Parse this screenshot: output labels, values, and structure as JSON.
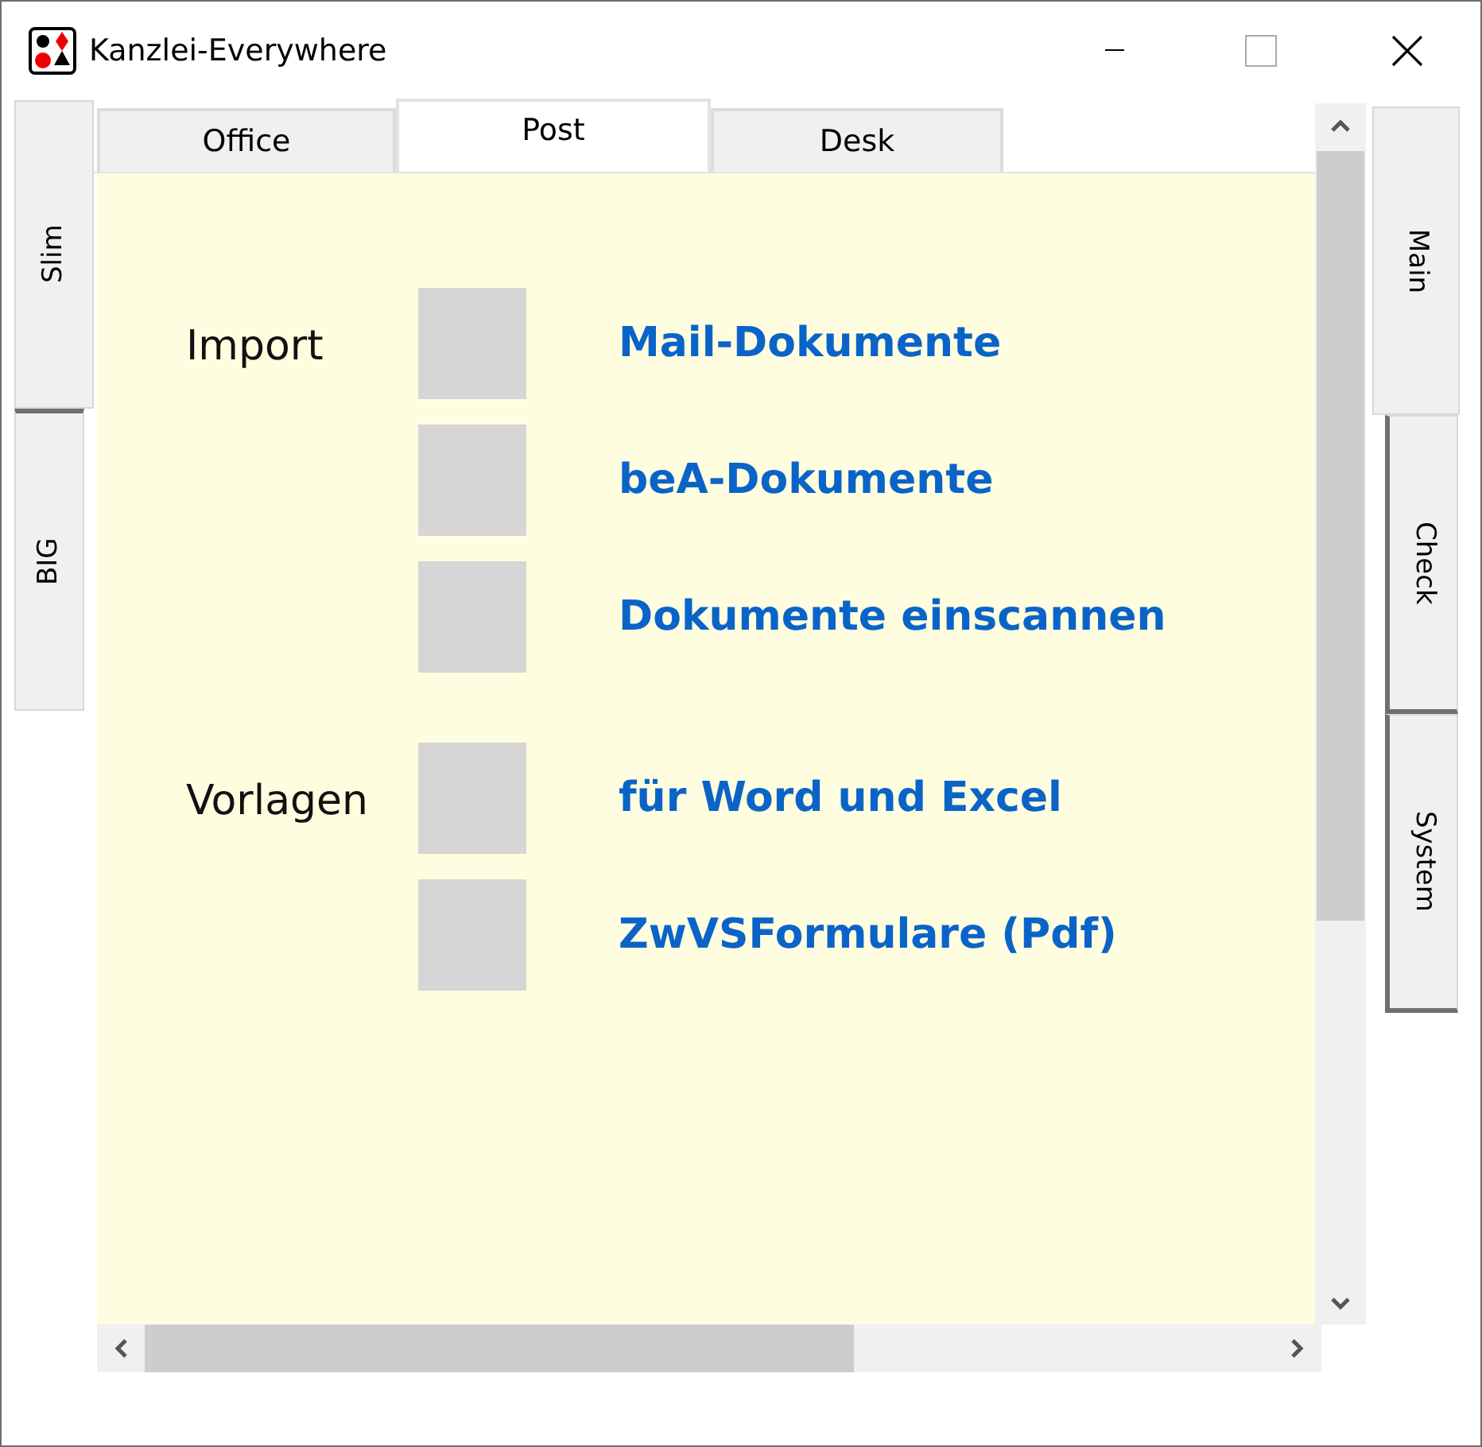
{
  "window": {
    "title": "Kanzlei-Everywhere"
  },
  "left_tabs": [
    {
      "label": "Slim",
      "selected": true
    },
    {
      "label": "BIG",
      "selected": false
    }
  ],
  "top_tabs": [
    {
      "label": "Office",
      "selected": false
    },
    {
      "label": "Post",
      "selected": true
    },
    {
      "label": "Desk",
      "selected": false
    }
  ],
  "groups": [
    {
      "label": "Import",
      "items": [
        {
          "label": "Mail-Dokumente"
        },
        {
          "label": "beA-Dokumente"
        },
        {
          "label": "Dokumente einscannen"
        }
      ]
    },
    {
      "label": "Vorlagen",
      "items": [
        {
          "label": "für Word und Excel"
        },
        {
          "label": "ZwVSFormulare (Pdf)"
        }
      ]
    }
  ],
  "right_tabs": [
    {
      "label": "Main",
      "selected": true
    },
    {
      "label": "Check",
      "selected": false
    },
    {
      "label": "System",
      "selected": false
    }
  ]
}
